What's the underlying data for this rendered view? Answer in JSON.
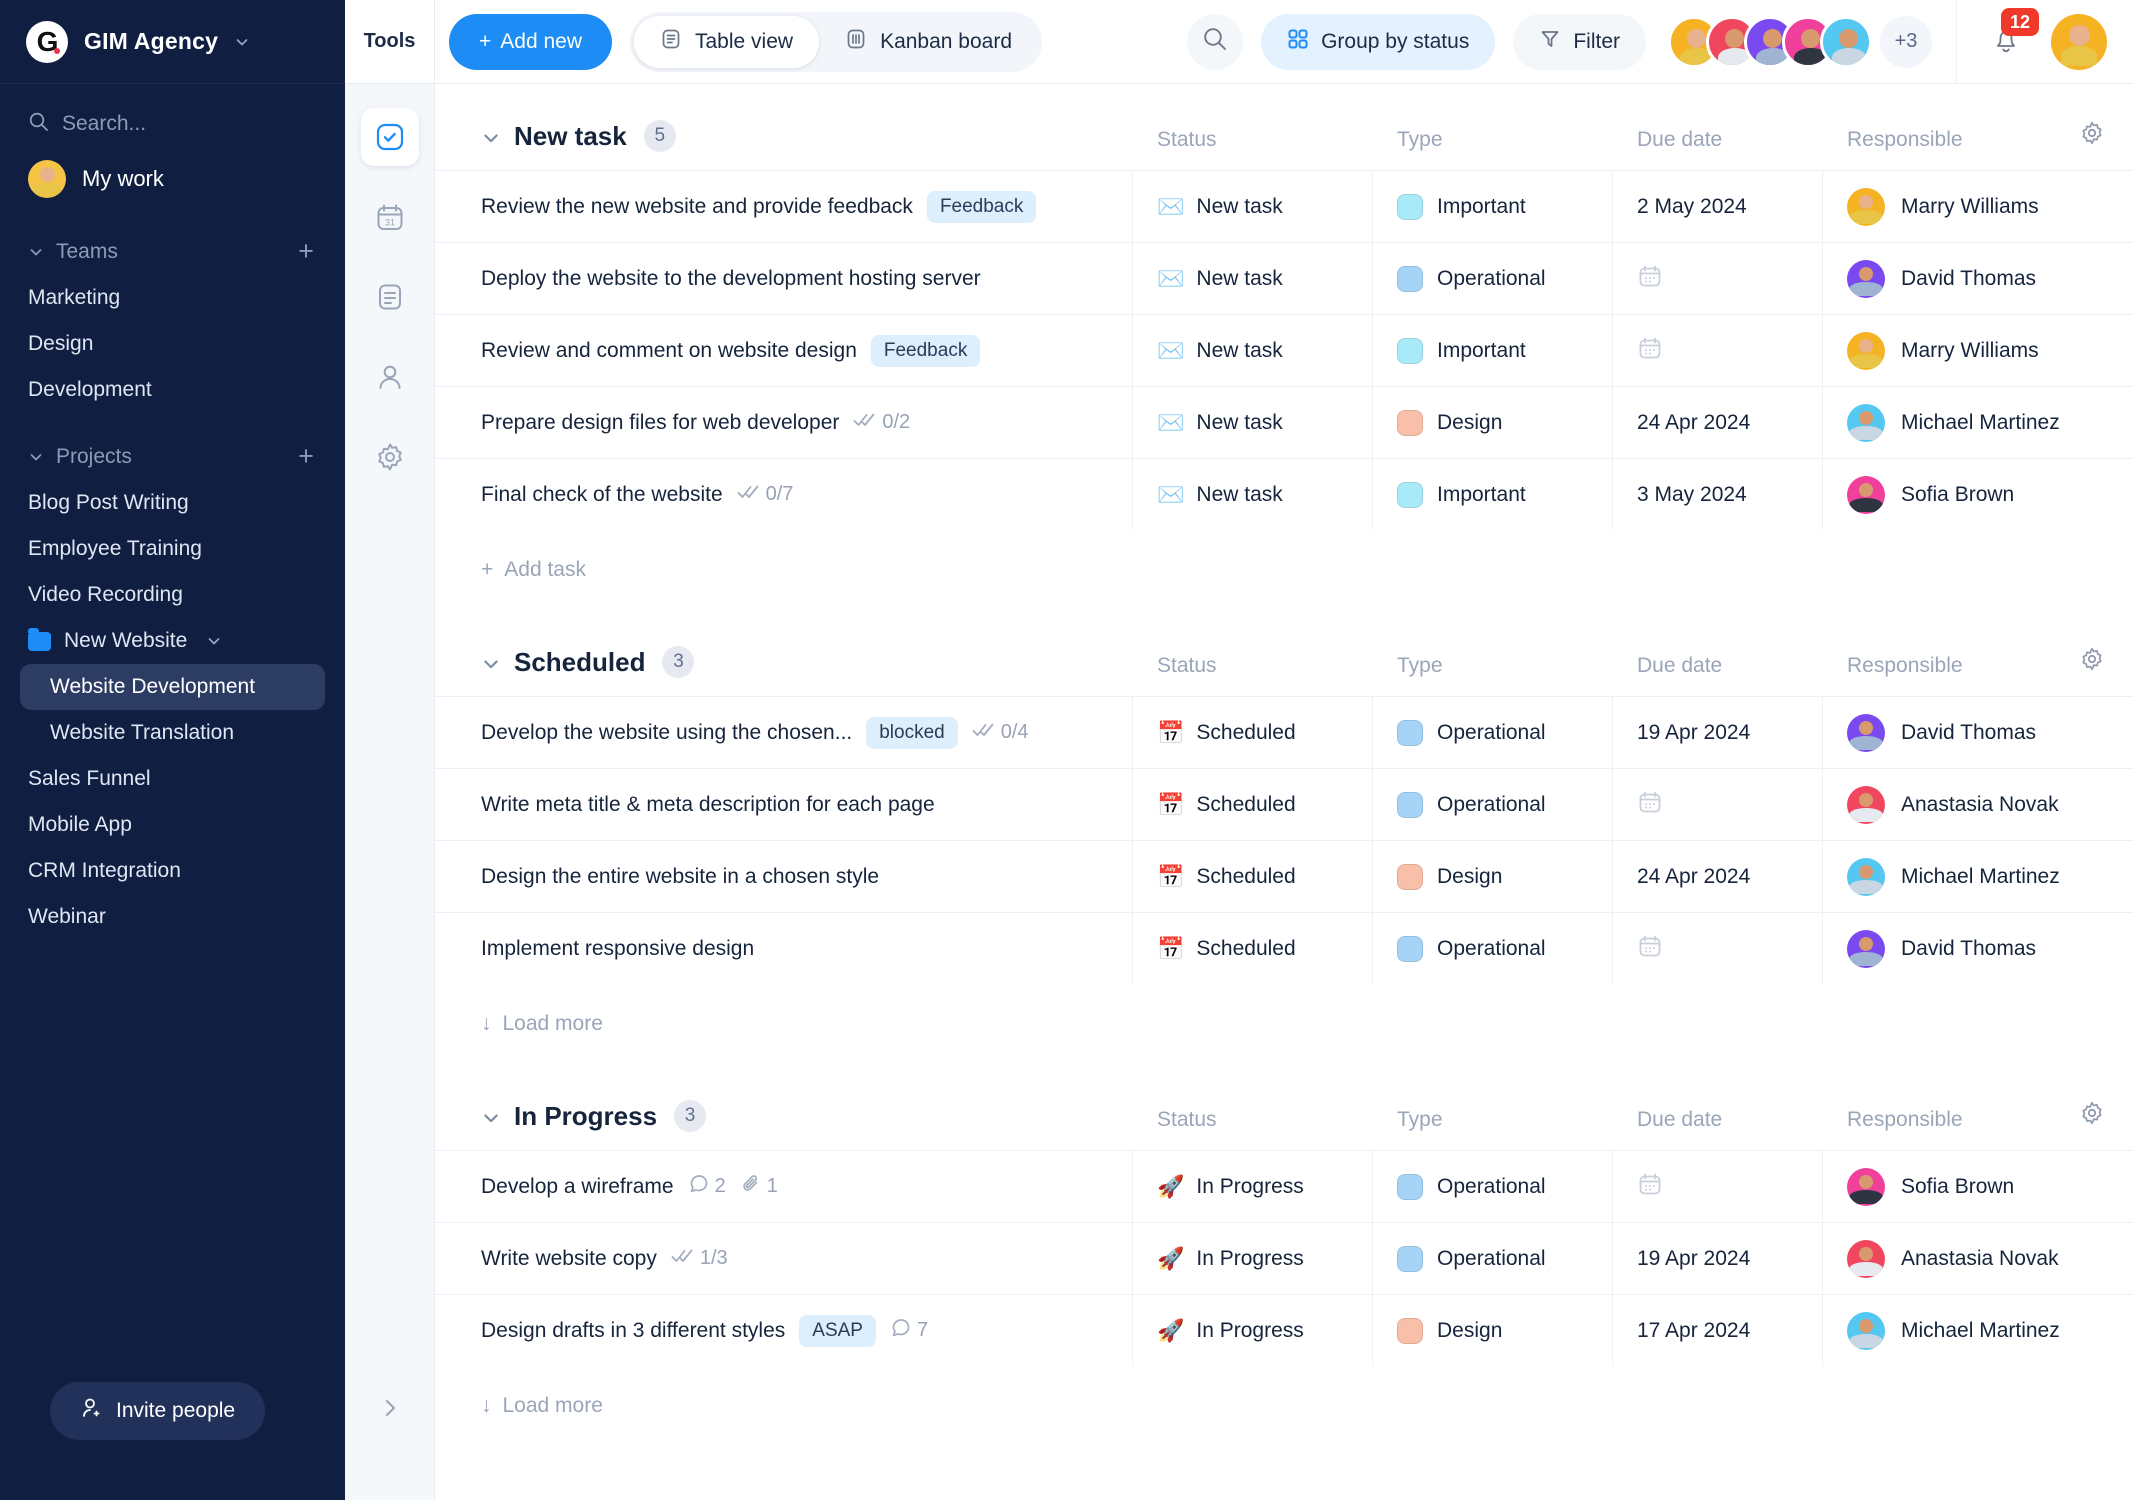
{
  "sidebar": {
    "workspace": {
      "name": "GIM Agency",
      "logo_letter": "G",
      "chevron": "chevron-down-icon"
    },
    "search": {
      "placeholder": "Search...",
      "icon": "search-icon"
    },
    "my_work": {
      "label": "My work"
    },
    "teams": {
      "label": "Teams",
      "add": "+",
      "items": [
        {
          "label": "Marketing"
        },
        {
          "label": "Design"
        },
        {
          "label": "Development"
        }
      ]
    },
    "projects": {
      "label": "Projects",
      "add": "+",
      "items": [
        {
          "label": "Blog Post Writing",
          "type": "item"
        },
        {
          "label": "Employee Training",
          "type": "item"
        },
        {
          "label": "Video Recording",
          "type": "item"
        },
        {
          "label": "New Website",
          "type": "folder"
        },
        {
          "label": "Website Development",
          "type": "sub",
          "active": true
        },
        {
          "label": "Website Translation",
          "type": "sub",
          "active": false
        },
        {
          "label": "Sales Funnel",
          "type": "item"
        },
        {
          "label": "Mobile App",
          "type": "item"
        },
        {
          "label": "CRM Integration",
          "type": "item"
        },
        {
          "label": "Webinar",
          "type": "item"
        }
      ]
    },
    "invite": {
      "label": "Invite people",
      "icon": "user-add-icon"
    }
  },
  "rail": {
    "title": "Tools",
    "items": [
      {
        "name": "tasks-icon",
        "active": true
      },
      {
        "name": "calendar-icon",
        "active": false
      },
      {
        "name": "document-icon",
        "active": false
      },
      {
        "name": "contacts-icon",
        "active": false
      },
      {
        "name": "settings-icon",
        "active": false
      }
    ],
    "expand": "chevron-right-icon"
  },
  "toolbar": {
    "add_new": "Add new",
    "views": [
      {
        "label": "Table view",
        "icon": "table-icon",
        "active": true
      },
      {
        "label": "Kanban board",
        "icon": "kanban-icon",
        "active": false
      }
    ],
    "search_icon": "search-icon",
    "group_by": {
      "label": "Group by status",
      "icon": "grid-icon"
    },
    "filter": {
      "label": "Filter",
      "icon": "funnel-icon"
    },
    "avatars_overflow": "+3",
    "notifications": {
      "count": "12",
      "icon": "bell-icon"
    },
    "profile": "avatar"
  },
  "columns": {
    "status": "Status",
    "type": "Type",
    "due": "Due date",
    "responsible": "Responsible"
  },
  "groups": [
    {
      "title": "New task",
      "count": "5",
      "footer": {
        "label": "Add task",
        "kind": "add"
      },
      "rows": [
        {
          "name": "Review the new website and provide feedback",
          "tag": "Feedback",
          "status": "New task",
          "status_emoji": "✉️",
          "type": "Important",
          "type_color": "#a8eaf7",
          "due": "2 May 2024",
          "responsible": "Marry Williams",
          "av": "yellow"
        },
        {
          "name": "Deploy the website to the development hosting server",
          "tag": "",
          "status": "New task",
          "status_emoji": "✉️",
          "type": "Operational",
          "type_color": "#a6d4f7",
          "due": "",
          "responsible": "David Thomas",
          "av": "violet"
        },
        {
          "name": "Review and comment on website design",
          "tag": "Feedback",
          "status": "New task",
          "status_emoji": "✉️",
          "type": "Important",
          "type_color": "#a8eaf7",
          "due": "",
          "responsible": "Marry Williams",
          "av": "yellow"
        },
        {
          "name": "Prepare design files for web developer",
          "tag": "",
          "subtasks": "0/2",
          "status": "New task",
          "status_emoji": "✉️",
          "type": "Design",
          "type_color": "#f9bfa8",
          "due": "24 Apr 2024",
          "responsible": "Michael Martinez",
          "av": "cyan"
        },
        {
          "name": "Final check of the website",
          "tag": "",
          "subtasks": "0/7",
          "status": "New task",
          "status_emoji": "✉️",
          "type": "Important",
          "type_color": "#a8eaf7",
          "due": "3 May 2024",
          "responsible": "Sofia Brown",
          "av": "pink"
        }
      ]
    },
    {
      "title": "Scheduled",
      "count": "3",
      "footer": {
        "label": "Load more",
        "kind": "load"
      },
      "rows": [
        {
          "name": "Develop the website using the chosen...",
          "tag": "blocked",
          "subtasks": "0/4",
          "status": "Scheduled",
          "status_emoji": "📅",
          "type": "Operational",
          "type_color": "#a6d4f7",
          "due": "19 Apr 2024",
          "responsible": "David Thomas",
          "av": "violet"
        },
        {
          "name": "Write meta title & meta description for each page",
          "tag": "",
          "status": "Scheduled",
          "status_emoji": "📅",
          "type": "Operational",
          "type_color": "#a6d4f7",
          "due": "",
          "responsible": "Anastasia Novak",
          "av": "red"
        },
        {
          "name": "Design the entire website in a chosen style",
          "tag": "",
          "status": "Scheduled",
          "status_emoji": "📅",
          "type": "Design",
          "type_color": "#f9bfa8",
          "due": "24 Apr 2024",
          "responsible": "Michael Martinez",
          "av": "cyan"
        },
        {
          "name": "Implement responsive design",
          "tag": "",
          "status": "Scheduled",
          "status_emoji": "📅",
          "type": "Operational",
          "type_color": "#a6d4f7",
          "due": "",
          "responsible": "David Thomas",
          "av": "violet"
        }
      ]
    },
    {
      "title": "In Progress",
      "count": "3",
      "footer": {
        "label": "Load more",
        "kind": "load"
      },
      "rows": [
        {
          "name": "Develop a wireframe",
          "tag": "",
          "comments": "2",
          "attachments": "1",
          "status": "In Progress",
          "status_emoji": "🚀",
          "type": "Operational",
          "type_color": "#a6d4f7",
          "due": "",
          "responsible": "Sofia Brown",
          "av": "pink"
        },
        {
          "name": "Write website copy",
          "tag": "",
          "subtasks": "1/3",
          "status": "In Progress",
          "status_emoji": "🚀",
          "type": "Operational",
          "type_color": "#a6d4f7",
          "due": "19 Apr 2024",
          "responsible": "Anastasia Novak",
          "av": "red"
        },
        {
          "name": "Design drafts in 3 different styles",
          "tag": "ASAP",
          "comments": "7",
          "status": "In Progress",
          "status_emoji": "🚀",
          "type": "Design",
          "type_color": "#f9bfa8",
          "due": "17 Apr 2024",
          "responsible": "Michael Martinez",
          "av": "cyan"
        }
      ]
    }
  ],
  "colors": {
    "accent": "#1d8df5",
    "sidebar_bg": "#101f41",
    "badge_red": "#f0392b",
    "tag_bg": "#ddeefc"
  }
}
